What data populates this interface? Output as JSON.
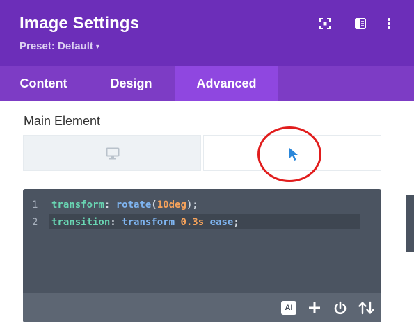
{
  "header": {
    "title": "Image Settings",
    "preset_label": "Preset: Default",
    "preset_caret": "▾",
    "icons": [
      "focus-icon",
      "sidebar-layout-icon",
      "more-vertical-icon"
    ]
  },
  "tabs": [
    {
      "label": "Content",
      "active": false
    },
    {
      "label": "Design",
      "active": false
    },
    {
      "label": "Advanced",
      "active": true
    }
  ],
  "section": {
    "label": "Main Element",
    "states": [
      {
        "icon": "desktop-icon",
        "selected": false
      },
      {
        "icon": "cursor-hover-icon",
        "selected": true
      }
    ]
  },
  "editor": {
    "lines": [
      {
        "number": "1",
        "tokens": [
          {
            "t": "transform",
            "c": "prop"
          },
          {
            "t": ": ",
            "c": "punc"
          },
          {
            "t": "rotate",
            "c": "fn"
          },
          {
            "t": "(",
            "c": "paren"
          },
          {
            "t": "10deg",
            "c": "num"
          },
          {
            "t": ");",
            "c": "paren"
          }
        ]
      },
      {
        "number": "2",
        "tokens": [
          {
            "t": "transition",
            "c": "prop"
          },
          {
            "t": ": ",
            "c": "punc"
          },
          {
            "t": "transform ",
            "c": "fn"
          },
          {
            "t": "0.3s",
            "c": "num"
          },
          {
            "t": " ease",
            "c": "fn"
          },
          {
            "t": ";",
            "c": "paren"
          }
        ]
      }
    ],
    "toolbar": {
      "ai_label": "AI",
      "icons": [
        "ai-icon",
        "plus-icon",
        "power-icon",
        "sort-arrows-icon"
      ]
    }
  },
  "colors": {
    "header": "#6c2eb9",
    "tabs": "#7d3cc5",
    "active_tab": "#8f47e0",
    "editor_bg": "#4b5461",
    "annotation": "#e11d1d",
    "cursor_blue": "#2b87da"
  }
}
